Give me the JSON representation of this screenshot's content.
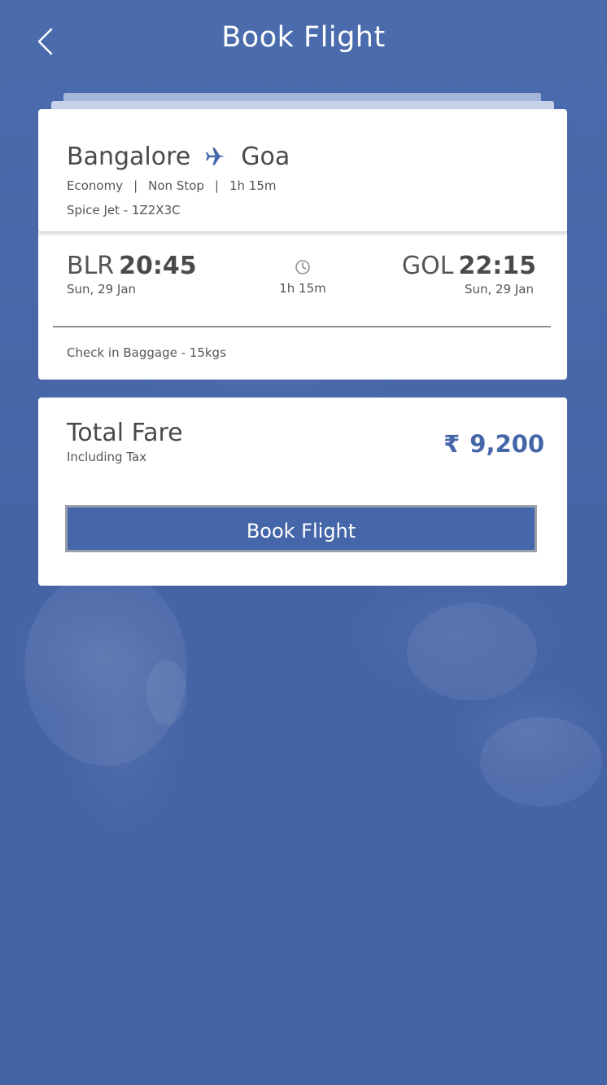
{
  "header": {
    "title": "Book Flight",
    "back_icon": "chevron-left-icon"
  },
  "flight": {
    "origin_city": "Bangalore",
    "destination_city": "Goa",
    "route_icon": "airplane-icon",
    "cabin_class": "Economy",
    "stops": "Non Stop",
    "duration": "1h 15m",
    "separator": "|",
    "flight_number": "Spice Jet - 1Z2X3C",
    "departure": {
      "code": "BLR",
      "time": "20:45",
      "date": "Sun, 29 Jan"
    },
    "arrival": {
      "code": "GOL",
      "time": "22:15",
      "date": "Sun, 29 Jan"
    },
    "duration_icon": "clock-icon",
    "baggage": "Check in Baggage - 15kgs"
  },
  "fare": {
    "label": "Total Fare",
    "sublabel": "Including Tax",
    "currency_symbol": "₹",
    "amount": "9,200",
    "book_button_label": "Book Flight"
  },
  "colors": {
    "background": "#4566a8",
    "accent": "#4566a8",
    "card": "#ffffff",
    "button_border": "#9aa0ab"
  }
}
